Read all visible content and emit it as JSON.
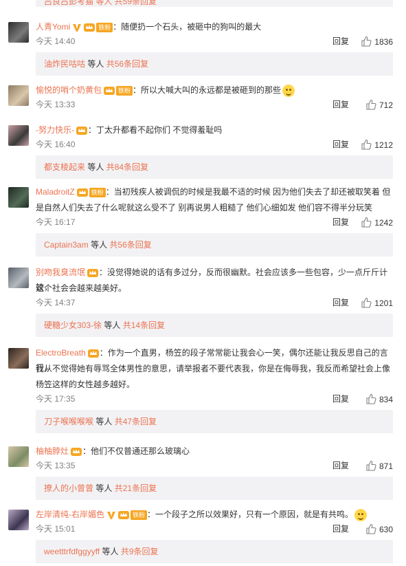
{
  "top_partial": "吕良吕彭考猫 等人 共59条回复",
  "ui": {
    "reply": "回复",
    "others": "等人"
  },
  "comments": [
    {
      "user": "人青Yomi",
      "vip": true,
      "fan": "铁粉",
      "text": "：随便扔一个石头，被砸中的狗叫的最大",
      "text2": "",
      "emoji": false,
      "time": "今天 14:40",
      "likes": "1836",
      "sub": {
        "user": "油炸民咕咕",
        "count": "共56条回复"
      }
    },
    {
      "user": "愉悦的哨个奶黄包",
      "vip": false,
      "fan": "铁粉",
      "text": "：所以大喊大叫的永远都是被砸到的那些",
      "text2": "",
      "emoji": true,
      "time": "今天 13:33",
      "likes": "712",
      "sub": null
    },
    {
      "user": "-努力快乐-",
      "vip": false,
      "fan": "",
      "text": "：丁太升都看不起你们 不觉得羞耻吗",
      "text2": "",
      "emoji": false,
      "time": "今天 16:40",
      "likes": "1212",
      "sub": {
        "user": "都支棱起来",
        "count": "共84条回复"
      }
    },
    {
      "user": "MaladroitZ",
      "vip": false,
      "fan": "铁粉",
      "text": "：当初残疾人被调侃的时候是我最不适的时候 因为他们失去了却还被取笑着 但",
      "text2": "是自然人们失去了什么呢就这么受不了 别再说男人粗糙了 他们心细如发 他们容不得半分玩笑",
      "emoji": false,
      "time": "今天 16:17",
      "likes": "1242",
      "sub": {
        "user": "Captain3am",
        "count": "共56条回复"
      }
    },
    {
      "user": "别吻我臭流氓",
      "vip": false,
      "fan": "",
      "text": "：没觉得她说的话有多过分，反而很幽默。社会应该多一些包容，少一点斤斤计较，",
      "text2": "这个社会会越来越美好。",
      "emoji": false,
      "time": "今天 14:37",
      "likes": "1201",
      "sub": {
        "user": "硬糖少女303-徐",
        "count": "共14条回复"
      }
    },
    {
      "user": "ElectroBreath",
      "vip": false,
      "fan": "",
      "text": "：作为一个直男，杨笠的段子常常能让我会心一笑，偶尔还能让我反思自己的言行，",
      "text2": "我从不觉得她有辱骂全体男性的意思，请举报者不要代表我，你是在侮辱我，我反而希望社会上像",
      "text3": "杨笠这样的女性越多越好。",
      "emoji": false,
      "time": "今天 17:35",
      "likes": "834",
      "sub": {
        "user": "刀子喉喉喉喉",
        "count": "共47条回复"
      }
    },
    {
      "user": "柚柚脖灶",
      "vip": false,
      "fan": "",
      "text": "：他们不仅普通还那么玻璃心",
      "text2": "",
      "emoji": false,
      "time": "今天 13:35",
      "likes": "871",
      "sub": {
        "user": "撩人的小曾曾",
        "count": "共21条回复"
      }
    },
    {
      "user": "左岸清纯-右岸媚色",
      "vip": true,
      "fan": "铁粉",
      "text": "：一个段子之所以效果好，只有一个原因，就是有共鸣。",
      "text2": "",
      "emoji": true,
      "time": "今天 15:01",
      "likes": "630",
      "sub": {
        "user": "weetttrfdfggyyff",
        "count": "共9条回复"
      }
    }
  ],
  "colors": {
    "accent": "#eb7350",
    "subbg": "#f2f2f5",
    "meta": "#808080"
  }
}
